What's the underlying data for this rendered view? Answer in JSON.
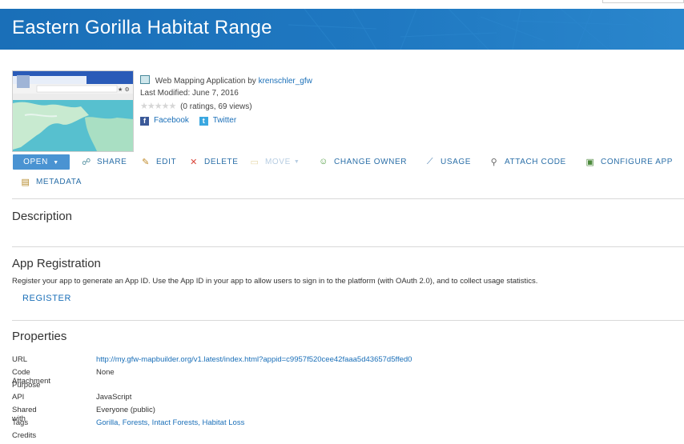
{
  "header": {
    "title": "Eastern Gorilla Habitat Range"
  },
  "item": {
    "type_label": "Web Mapping Application by",
    "owner": "krenschler_gfw",
    "last_modified": "Last Modified: June 7, 2016",
    "ratings": "(0 ratings, 69 views)",
    "rating_stars": 0,
    "social": {
      "facebook": "Facebook",
      "twitter": "Twitter"
    }
  },
  "toolbar": {
    "open": "OPEN",
    "share": "SHARE",
    "edit": "EDIT",
    "delete": "DELETE",
    "move": "MOVE",
    "change_owner": "CHANGE OWNER",
    "usage": "USAGE",
    "attach_code": "ATTACH CODE",
    "configure_app": "CONFIGURE APP",
    "metadata": "METADATA"
  },
  "sections": {
    "description": {
      "title": "Description"
    },
    "app_registration": {
      "title": "App Registration",
      "text": "Register your app to generate an App ID. Use the App ID in your app to allow users to sign in to the platform (with OAuth 2.0), and to collect usage statistics.",
      "register": "REGISTER"
    },
    "properties": {
      "title": "Properties",
      "rows": [
        {
          "label": "URL",
          "value": "http://my.gfw-mapbuilder.org/v1.latest/index.html?appid=c9957f520cee42faaa5d43657d5ffed0"
        },
        {
          "label": "Code Attachment",
          "value": "None"
        },
        {
          "label": "Purpose",
          "value": ""
        },
        {
          "label": "API",
          "value": "JavaScript"
        },
        {
          "label": "Shared with",
          "value": "Everyone (public)"
        },
        {
          "label": "Tags",
          "value": "Gorilla, Forests, Intact Forests, Habitat Loss"
        },
        {
          "label": "Credits",
          "value": ""
        }
      ]
    }
  },
  "colors": {
    "banner": "#1f78c1",
    "link": "#1a6fb8",
    "open_button": "#4a93d2"
  }
}
